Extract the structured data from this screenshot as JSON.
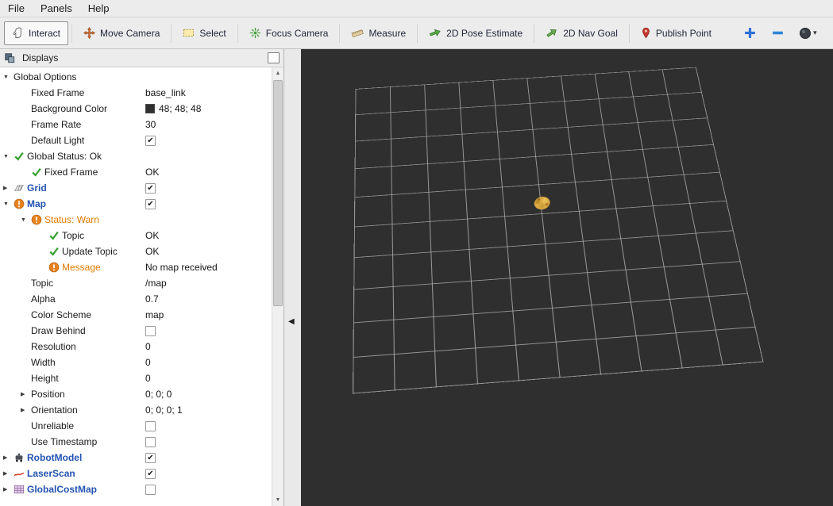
{
  "menu": {
    "items": [
      {
        "label": "File"
      },
      {
        "label": "Panels"
      },
      {
        "label": "Help"
      }
    ]
  },
  "toolbar": {
    "tools": [
      {
        "label": "Interact",
        "icon": "hand-icon",
        "active": true
      },
      {
        "label": "Move Camera",
        "icon": "move-camera-icon",
        "active": false
      },
      {
        "label": "Select",
        "icon": "select-box-icon",
        "active": false
      },
      {
        "label": "Focus Camera",
        "icon": "focus-camera-icon",
        "active": false
      },
      {
        "label": "Measure",
        "icon": "ruler-icon",
        "active": false
      },
      {
        "label": "2D Pose Estimate",
        "icon": "pose-arrow-icon",
        "active": false
      },
      {
        "label": "2D Nav Goal",
        "icon": "nav-goal-arrow-icon",
        "active": false
      },
      {
        "label": "Publish Point",
        "icon": "map-pin-icon",
        "active": false
      }
    ],
    "actions": [
      {
        "name": "add-tool-button",
        "icon": "plus-icon",
        "has_dropdown": false
      },
      {
        "name": "remove-tool-button",
        "icon": "minus-icon",
        "has_dropdown": false
      },
      {
        "name": "tool-options-button",
        "icon": "eye-icon",
        "has_dropdown": true
      }
    ]
  },
  "displays_panel": {
    "title": "Displays",
    "rows": [
      {
        "level": 0,
        "expander": "down",
        "label": "Global Options",
        "value_type": "none"
      },
      {
        "level": 1,
        "label": "Fixed Frame",
        "value_type": "text",
        "value": "base_link"
      },
      {
        "level": 1,
        "label": "Background Color",
        "value_type": "color",
        "value": "48; 48; 48",
        "swatch": "#303030"
      },
      {
        "level": 1,
        "label": "Frame Rate",
        "value_type": "text",
        "value": "30"
      },
      {
        "level": 1,
        "label": "Default Light",
        "value_type": "checkbox",
        "checked": true
      },
      {
        "level": 0,
        "expander": "down",
        "icon": "check-icon",
        "label": "Global Status: Ok",
        "value_type": "none"
      },
      {
        "level": 1,
        "icon": "check-icon",
        "label": "Fixed Frame",
        "value_type": "text",
        "value": "OK"
      },
      {
        "level": 0,
        "expander": "right",
        "icon": "grid-icon",
        "label": "Grid",
        "style": "display",
        "value_type": "checkbox",
        "checked": true
      },
      {
        "level": 0,
        "expander": "down",
        "icon": "warn-icon",
        "label": "Map",
        "style": "display",
        "value_type": "checkbox",
        "checked": true
      },
      {
        "level": 1,
        "expander": "down",
        "icon": "warn-icon",
        "label": "Status: Warn",
        "style": "warn",
        "value_type": "none"
      },
      {
        "level": 2,
        "icon": "check-icon",
        "label": "Topic",
        "value_type": "text",
        "value": "OK"
      },
      {
        "level": 2,
        "icon": "check-icon",
        "label": "Update Topic",
        "value_type": "text",
        "value": "OK"
      },
      {
        "level": 2,
        "icon": "warn-icon",
        "label": "Message",
        "style": "warn",
        "value_type": "text",
        "value": "No map received"
      },
      {
        "level": 1,
        "label": "Topic",
        "value_type": "text",
        "value": "/map"
      },
      {
        "level": 1,
        "label": "Alpha",
        "value_type": "text",
        "value": "0.7"
      },
      {
        "level": 1,
        "label": "Color Scheme",
        "value_type": "text",
        "value": "map"
      },
      {
        "level": 1,
        "label": "Draw Behind",
        "value_type": "checkbox",
        "checked": false
      },
      {
        "level": 1,
        "label": "Resolution",
        "value_type": "text",
        "value": "0"
      },
      {
        "level": 1,
        "label": "Width",
        "value_type": "text",
        "value": "0"
      },
      {
        "level": 1,
        "label": "Height",
        "value_type": "text",
        "value": "0"
      },
      {
        "level": 1,
        "expander": "right",
        "label": "Position",
        "value_type": "text",
        "value": "0; 0; 0"
      },
      {
        "level": 1,
        "expander": "right",
        "label": "Orientation",
        "value_type": "text",
        "value": "0; 0; 0; 1"
      },
      {
        "level": 1,
        "label": "Unreliable",
        "value_type": "checkbox",
        "checked": false
      },
      {
        "level": 1,
        "label": "Use Timestamp",
        "value_type": "checkbox",
        "checked": false
      },
      {
        "level": 0,
        "expander": "right",
        "icon": "robot-icon",
        "label": "RobotModel",
        "style": "display",
        "value_type": "checkbox",
        "checked": true
      },
      {
        "level": 0,
        "expander": "right",
        "icon": "laser-icon",
        "label": "LaserScan",
        "style": "display",
        "value_type": "checkbox",
        "checked": true
      },
      {
        "level": 0,
        "expander": "right",
        "icon": "costmap-icon",
        "label": "GlobalCostMap",
        "style": "display",
        "value_type": "checkbox",
        "checked": false
      }
    ]
  },
  "viewport": {
    "background": "#2f2f2f",
    "grid_color": "#a8a8a8",
    "robot_color": "#dca943",
    "grid_cells": 10
  },
  "colors": {
    "display_name_blue": "#2353b2",
    "warn_orange": "#e07a00",
    "ok_green": "#36a02e",
    "background_color_value": "#303030"
  }
}
